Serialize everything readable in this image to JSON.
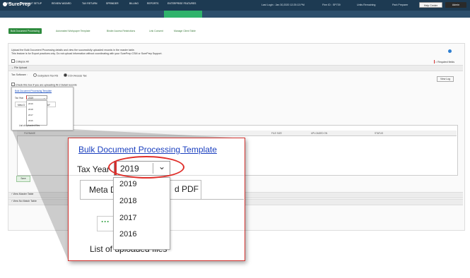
{
  "app": {
    "logo_text": "SurePrep",
    "last_login": "Last Login : Jan 30,2020 12:25:13 PM",
    "firm_id": "Firm ID : SP739",
    "units_remaining": "Units Remaining",
    "park_preparer": "Park Preparer",
    "help_center": "Help Center",
    "admin": "Admin"
  },
  "nav": {
    "items": [
      "USERS",
      "ACCOUNT SETUP",
      "REVIEW WIZARD",
      "TAX RETURN",
      "SPRINDER",
      "BILLING",
      "REPORTS",
      "ENTERPRISE FEATURES"
    ]
  },
  "subtabs": [
    "Bulk Document Processing",
    "Automated Workpaper Template",
    "Binder Access Restrictions",
    "Link Consent",
    "Manage Client Table"
  ],
  "page": {
    "intro_line1": "Upload the Bulk Document Processing details and view the successfully uploaded records in the master table.",
    "intro_line2": "This feature is for Export practices only. Do not upload information without coordinating with your SurePrep CSM or SurePrep Support.",
    "collapse_all": "Collapse All",
    "required_fields": "= Required fields",
    "file_upload": "File Upload",
    "tax_software_label": "Tax Software :",
    "tax_software_option1": "GoSystem Tax RS",
    "tax_software_option2": "CCH Axcess Tax",
    "check_detail": "Check this box if you are uploading W-2 Detail records",
    "view_log": "View Log",
    "table_headers": [
      "FILENAME",
      "FILE SIZE",
      "UPLOADED ON",
      "STATUS"
    ],
    "save_button": "Save",
    "view_master_table": "View Master Table",
    "view_no_match_table": "View No Match Table"
  },
  "mini": {
    "template_link": "Bulk Document Processing Template",
    "tax_year_label": "Tax Year",
    "selected_year": "2019",
    "tab_label": "Meta D",
    "tab_label2": "d PDF",
    "year_options": [
      "2019",
      "2018",
      "2017",
      "2016"
    ],
    "list_label": "List of uploaded files"
  },
  "callout": {
    "template_link": "Bulk Document Processing Template",
    "tax_year_label": "Tax Year",
    "selected_year": "2019",
    "chevron": "⌄",
    "tab_label": "Meta D",
    "tab_label2": "d PDF",
    "year_options": [
      "2019",
      "2018",
      "2017",
      "2016"
    ],
    "green_button": "···",
    "list_label": "List of uploaded files"
  }
}
